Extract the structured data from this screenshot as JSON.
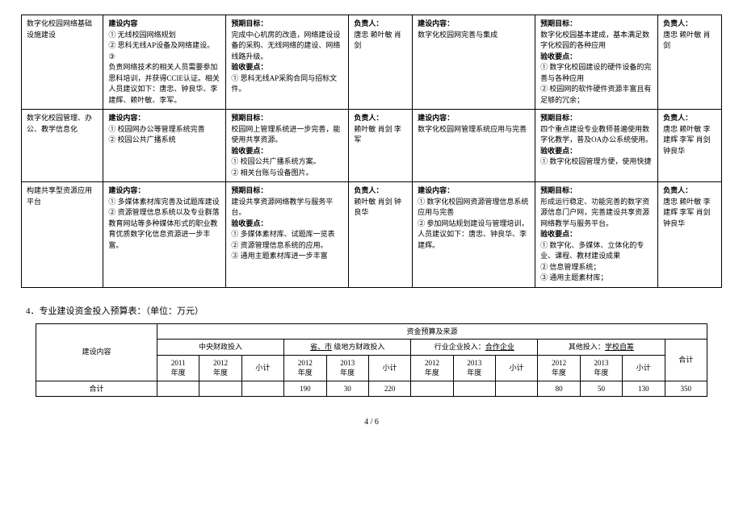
{
  "rows": [
    {
      "project": "数字化校园网络基础设施建设",
      "content_hdr": "建设内容",
      "content_items": [
        "① 无线校园网络规划",
        "② 思科无线AP设备及网络建设。",
        "③",
        "负责网络技术的相关人员需要参加思科培训，并获得CCIE认证。相关人员建议如下：唐忠、钟良华、李建辉、赖叶敏、李军。"
      ],
      "goal_hdr": "预期目标：",
      "goal_text": "完成中心机房的改造，网络建设设备的采购、无线网络的建设、网络线路升级。",
      "check_hdr": "验收要点：",
      "check_items": [
        "① 思科无线AP采购合同与招标文件。"
      ],
      "resp_hdr": "负责人：",
      "resp_text": "唐忠 赖叶敏 肖剑",
      "content2_hdr": "建设内容：",
      "content2_text": "数字化校园网完善与集成",
      "goal2_hdr": "预期目标：",
      "goal2_text": "数字化校园基本建成，基本满足数字化校园的各种应用",
      "check2_hdr": "验收要点：",
      "check2_items": [
        "① 数字化校园建设的硬件设备的完善与各种应用",
        "② 校园网的软件硬件资源丰富且有足够的冗余；"
      ],
      "resp2_hdr": "负责人：",
      "resp2_text": "唐忠 赖叶敏 肖剑"
    },
    {
      "project": "数字化校园管理、办公、教学信息化",
      "content_hdr": "建设内容：",
      "content_items": [
        "① 校园网办公等管理系统完善",
        "② 校园公共广播系统"
      ],
      "goal_hdr": "预期目标：",
      "goal_text": "校园网上管理系统进一步完善，能使用共享资源。",
      "check_hdr": "验收要点：",
      "check_items": [
        "① 校园公共广播系统方案。",
        "② 相关台账与设备图片。"
      ],
      "resp_hdr": "负责人：",
      "resp_text": "赖叶敏 肖剑 李军",
      "content2_hdr": "建设内容：",
      "content2_text": "数字化校园网管理系统应用与完善",
      "goal2_hdr": "预期目标：",
      "goal2_text": "四个重点建设专业教师普遍使用数字化教学，普及OA办公系统使用。",
      "check2_hdr": "验收要点：",
      "check2_items": [
        "① 数字化校园管理方便，使用快捷"
      ],
      "resp2_hdr": "负责人：",
      "resp2_text": "唐忠 赖叶敏 李建辉 李军 肖剑 钟良华"
    },
    {
      "project": "构建共享型资源应用平台",
      "content_hdr": "建设内容：",
      "content_items": [
        "① 多媒体素材库完善及试题库建设",
        "② 资源管理信息系统以及专业群落教育网站等多种媒体形式的职业教育优质数字化信息资源进一步丰富。"
      ],
      "goal_hdr": "预期目标：",
      "goal_text": "建设共享资源网络教学与服务平台。",
      "check_hdr": "验收要点：",
      "check_items": [
        "① 多媒体素材库、试题库一览表",
        "② 资源管理信息系统的应用。",
        "③ 通用主题素材库进一步丰富"
      ],
      "resp_hdr": "负责人：",
      "resp_text": "赖叶敏 肖剑 钟良华",
      "content2_hdr": "建设内容：",
      "content2_items": [
        "① 数字化校园网资源管理信息系统应用与完善",
        "② 参加网站规划建设与管理培训，人员建议如下：唐忠、钟良华、李建辉。"
      ],
      "goal2_hdr": "预期目标：",
      "goal2_text": "形成运行稳定、功能完善的数字资源信息门户网，完善建设共享资源网络教学与服务平台。",
      "check2_hdr": "验收要点：",
      "check2_items": [
        "① 数字化、多媒体、立体化的专业、课程、教材建设成果",
        "② 信息管理系统；",
        "③ 通用主题素材库；"
      ],
      "resp2_hdr": "负责人：",
      "resp2_text": "唐忠 赖叶敏 李建辉 李军 肖剑 钟良华"
    }
  ],
  "section_heading": "4．专业建设资金投入预算表：（单位：万元）",
  "budget": {
    "header_top": "资金预算及来源",
    "content_label": "建设内容",
    "groups": [
      {
        "label": "中央财政投入",
        "extra": ""
      },
      {
        "label": "省、市",
        "extra": "级地方财政投入"
      },
      {
        "label": "行业企业投入：",
        "extra": "合作企业"
      },
      {
        "label": "其他投入：",
        "extra": "学校自筹"
      }
    ],
    "year_cols": [
      "2011 年度",
      "2012 年度",
      "小计",
      "2012 年度",
      "2013 年度",
      "小计",
      "2012 年度",
      "2013 年度",
      "小计",
      "2012 年度",
      "2013 年度",
      "小计"
    ],
    "total_label": "合计",
    "grand_total_label": "合计",
    "values": [
      "",
      "",
      "",
      "190",
      "30",
      "220",
      "",
      "",
      "",
      "80",
      "50",
      "130",
      "350"
    ]
  },
  "footer": "4 / 6"
}
